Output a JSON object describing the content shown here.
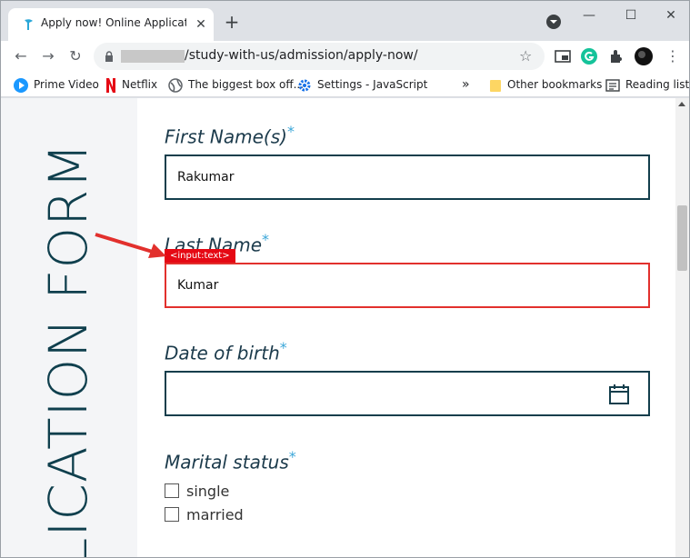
{
  "tab": {
    "title": "Apply now! Online Application Fo",
    "close": "✕",
    "newtab": "+"
  },
  "window_controls": {
    "minimize": "—",
    "maximize": "☐",
    "close": "✕"
  },
  "toolbar": {
    "back": "←",
    "forward": "→",
    "reload": "↻",
    "url_path": "/study-with-us/admission/apply-now/",
    "star": "☆",
    "menu": "⋮"
  },
  "bookmarks": {
    "items": [
      {
        "label": "Prime Video"
      },
      {
        "label": "Netflix"
      },
      {
        "label": "The biggest box off..."
      },
      {
        "label": "Settings - JavaScript"
      }
    ],
    "overflow": "»",
    "other": "Other bookmarks",
    "reading_list": "Reading list"
  },
  "page": {
    "vertical_title": "LICATION FORM",
    "required_mark": "*",
    "fields": {
      "first_name": {
        "label": "First Name(s)",
        "value": "Rakumar"
      },
      "last_name": {
        "label": "Last Name",
        "value": "Kumar"
      },
      "dob": {
        "label": "Date of birth",
        "value": ""
      },
      "marital": {
        "label": "Marital status",
        "options": [
          "single",
          "married"
        ]
      }
    },
    "annotation_tag": "<input:text>"
  },
  "colors": {
    "accent": "#133e4c",
    "error": "#e2302d",
    "required": "#3aa6d8",
    "tag": "#e50914"
  }
}
